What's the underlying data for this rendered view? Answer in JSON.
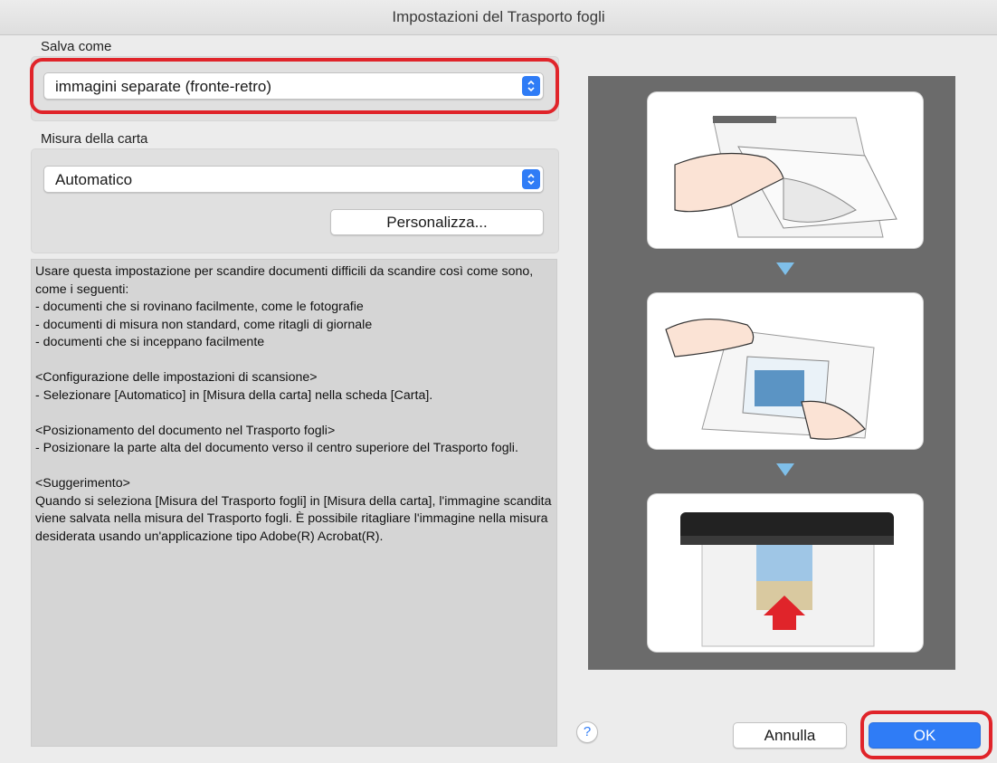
{
  "window": {
    "title": "Impostazioni del Trasporto fogli"
  },
  "save_as": {
    "label": "Salva come",
    "selected": "immagini separate (fronte-retro)"
  },
  "paper_size": {
    "label": "Misura della carta",
    "selected": "Automatico",
    "customize_label": "Personalizza..."
  },
  "description": {
    "paragraphs": [
      "Usare questa impostazione per scandire documenti difficili da scandire così come sono, come i seguenti:\n- documenti che si rovinano facilmente, come le fotografie\n- documenti di misura non standard, come ritagli di giornale\n- documenti che si inceppano facilmente",
      "<Configurazione delle impostazioni di scansione>\n- Selezionare [Automatico] in [Misura della carta] nella scheda [Carta].",
      "<Posizionamento del documento nel Trasporto fogli>\n- Posizionare la parte alta del documento verso il centro superiore del Trasporto fogli.",
      "<Suggerimento>\nQuando si seleziona [Misura del Trasporto fogli] in [Misura della carta], l'immagine scandita viene salvata nella misura del Trasporto fogli. È possibile ritagliare l'immagine nella misura desiderata usando un'applicazione tipo Adobe(R) Acrobat(R)."
    ]
  },
  "help": {
    "label": "?"
  },
  "buttons": {
    "cancel": "Annulla",
    "ok": "OK"
  },
  "colors": {
    "accent": "#2f7cf6",
    "highlight": "#e0242a",
    "preview_bg": "#6b6b6b",
    "step_arrow": "#7fbfe9"
  }
}
